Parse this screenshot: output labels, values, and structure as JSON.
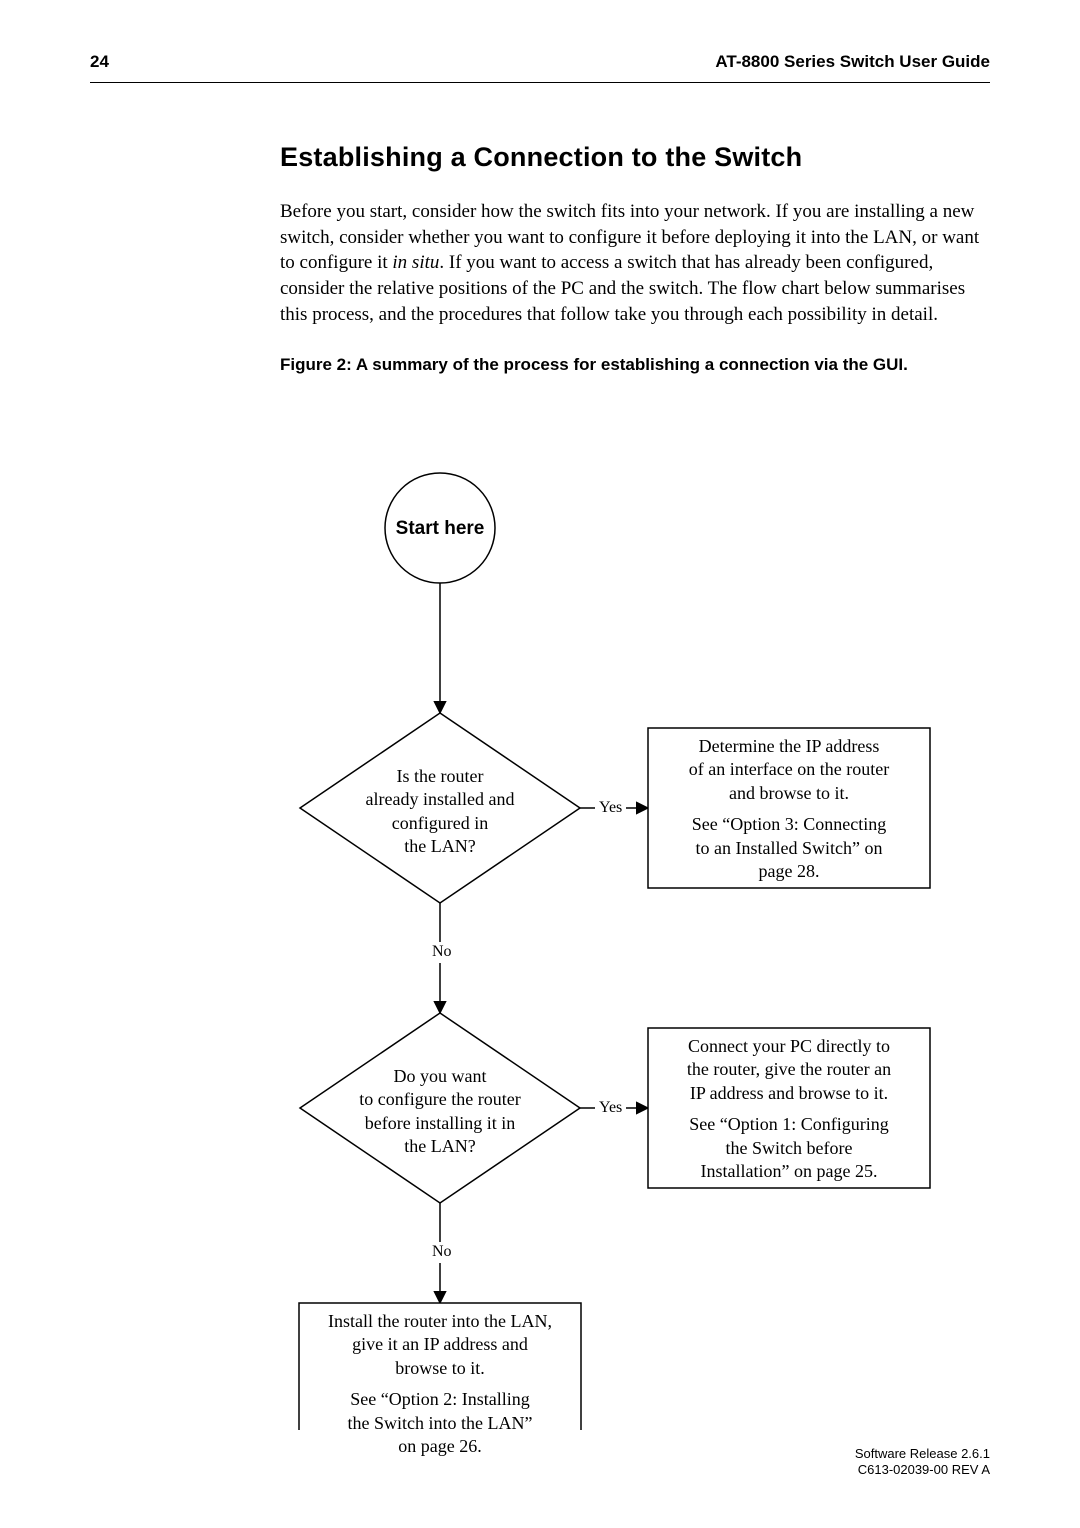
{
  "header": {
    "page_number": "24",
    "doc_title": "AT-8800 Series Switch User Guide"
  },
  "section": {
    "title": "Establishing a Connection to the Switch",
    "body_pre": "Before you start, consider how the switch fits into your network. If you are installing a new switch, consider whether you want to configure it before deploying it into the LAN, or want to configure it ",
    "body_em": "in situ",
    "body_post": ". If you want to access a switch that has already been configured, consider the relative positions of the PC and the switch. The flow chart below summarises this process, and the procedures that follow take you through each possibility in detail.",
    "figure_caption": "Figure 2: A summary of the process for establishing a connection via the GUI."
  },
  "flow": {
    "start": "Start here",
    "decision1": {
      "l1": "Is the router",
      "l2": "already installed and",
      "l3": "configured in",
      "l4": "the LAN?"
    },
    "box1": {
      "l1": "Determine the IP address",
      "l2": "of an interface on the router",
      "l3": "and browse to it.",
      "ref1": "See “Option 3: Connecting",
      "ref2": "to an Installed Switch” on",
      "ref3": "page 28."
    },
    "decision2": {
      "l1": "Do you want",
      "l2": "to configure the router",
      "l3": "before installing it in",
      "l4": "the LAN?"
    },
    "box2": {
      "l1": "Connect your PC directly to",
      "l2": "the router, give the router an",
      "l3": "IP address and browse to it.",
      "ref1": "See “Option 1: Configuring",
      "ref2": "the Switch before",
      "ref3": "Installation” on page 25."
    },
    "box3": {
      "l1": "Install the router into the LAN,",
      "l2": "give it an IP address and",
      "l3": "browse to it.",
      "ref1": "See “Option 2: Installing",
      "ref2": "the Switch into the LAN”",
      "ref3": "on page 26."
    },
    "labels": {
      "yes": "Yes",
      "no": "No"
    }
  },
  "chart_data": {
    "type": "diagram",
    "diagram_type": "flow",
    "nodes": [
      {
        "id": "start",
        "kind": "start",
        "label": "Start here"
      },
      {
        "id": "d1",
        "kind": "decision",
        "label": "Is the router already installed and configured in the LAN?"
      },
      {
        "id": "b1",
        "kind": "process",
        "label": "Determine the IP address of an interface on the router and browse to it.",
        "ref": "See “Option 3: Connecting to an Installed Switch” on page 28."
      },
      {
        "id": "d2",
        "kind": "decision",
        "label": "Do you want to configure the router before installing it in the LAN?"
      },
      {
        "id": "b2",
        "kind": "process",
        "label": "Connect your PC directly to the router, give the router an IP address and browse to it.",
        "ref": "See “Option 1: Configuring the Switch before Installation” on page 25."
      },
      {
        "id": "b3",
        "kind": "process",
        "label": "Install the router into the LAN, give it an IP address and browse to it.",
        "ref": "See “Option 2: Installing the Switch into the LAN” on page 26."
      }
    ],
    "edges": [
      {
        "from": "start",
        "to": "d1",
        "label": ""
      },
      {
        "from": "d1",
        "to": "b1",
        "label": "Yes"
      },
      {
        "from": "d1",
        "to": "d2",
        "label": "No"
      },
      {
        "from": "d2",
        "to": "b2",
        "label": "Yes"
      },
      {
        "from": "d2",
        "to": "b3",
        "label": "No"
      }
    ]
  },
  "footer": {
    "l1": "Software Release 2.6.1",
    "l2": "C613-02039-00 REV A"
  }
}
